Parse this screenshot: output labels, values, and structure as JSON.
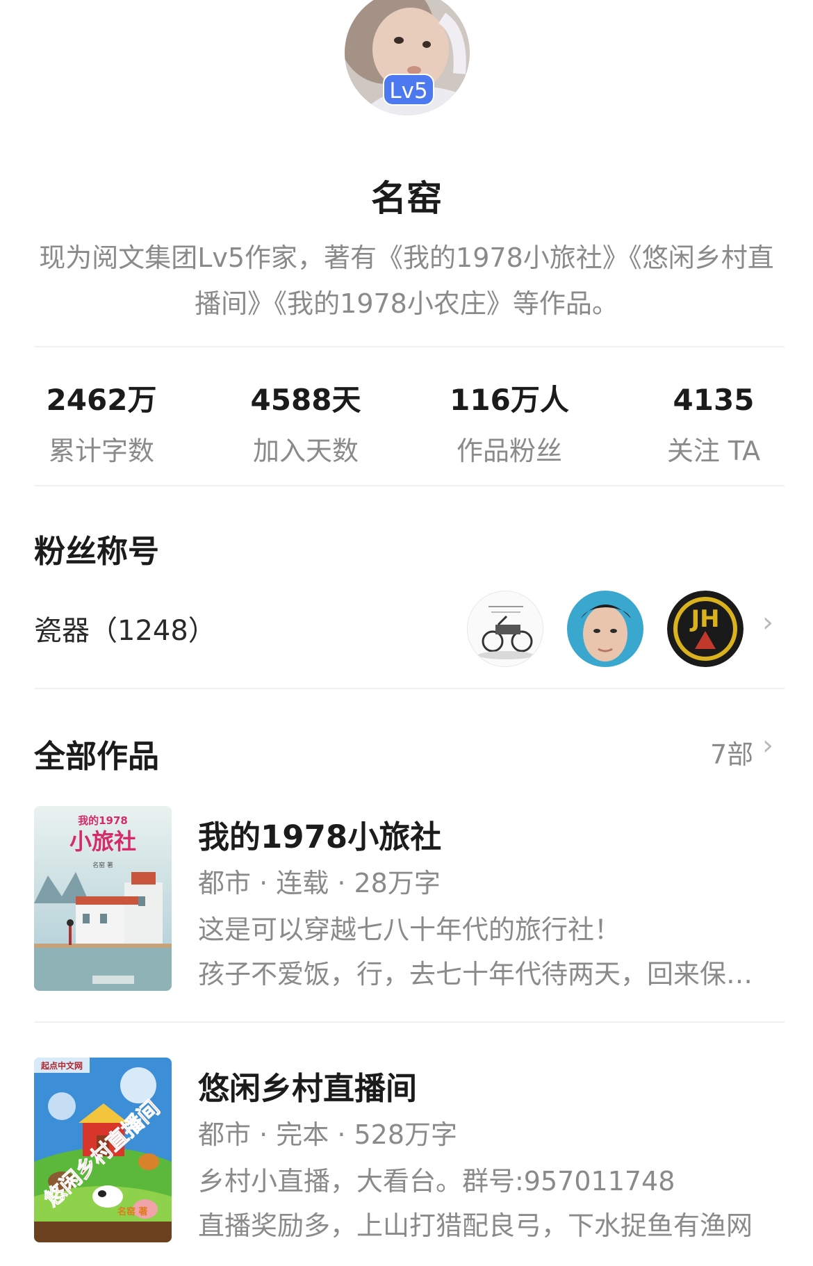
{
  "profile": {
    "level_badge": "Lv5",
    "name": "名窑",
    "intro": "现为阅文集团Lv5作家，著有《我的1978小旅社》《悠闲乡村直播间》《我的1978小农庄》等作品。"
  },
  "stats": [
    {
      "value": "2462万",
      "label": "累计字数"
    },
    {
      "value": "4588天",
      "label": "加入天数"
    },
    {
      "value": "116万人",
      "label": "作品粉丝"
    },
    {
      "value": "4135",
      "label": "关注 TA"
    }
  ],
  "fan_title": {
    "heading": "粉丝称号",
    "label": "瓷器（1248）",
    "avatars": [
      "vintage-car-avatar",
      "young-man-avatar",
      "jh-logo-avatar"
    ]
  },
  "works": {
    "heading": "全部作品",
    "count": "7部",
    "books": [
      {
        "title": "我的1978小旅社",
        "meta": "都市 · 连载 · 28万字",
        "desc1": "这是可以穿越七八十年代的旅行社！",
        "desc2": "孩子不爱饭，行，去七十年代待两天，回来保证吃得香",
        "cover_top": "我的1978",
        "cover_title": "小旅社",
        "cover_author": "名窑 著"
      },
      {
        "title": "悠闲乡村直播间",
        "meta": "都市 · 完本 · 528万字",
        "desc1": "乡村小直播，大看台。群号:957011748",
        "desc2": "直播奖励多，上山打猎配良弓，下水捉鱼有渔网",
        "cover_title": "悠闲乡村直播间",
        "cover_author": "名窑 著",
        "cover_brand": "起点中文网"
      }
    ]
  },
  "colors": {
    "badge": "#4c79f0",
    "text_primary": "#1b1b1b",
    "text_secondary": "#8a8a8a",
    "divider": "#f0f0f0"
  }
}
